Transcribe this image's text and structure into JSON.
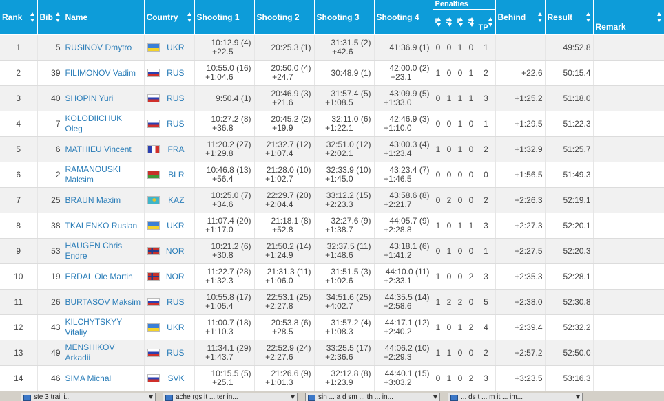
{
  "headers": {
    "rank": "Rank",
    "bib": "Bib",
    "name": "Name",
    "country": "Country",
    "shooting1": "Shooting 1",
    "shooting2": "Shooting 2",
    "shooting3": "Shooting 3",
    "shooting4": "Shooting 4",
    "penalties": "Penalties",
    "pen_cols": [
      "P",
      "S",
      "P",
      "S",
      "TP"
    ],
    "behind": "Behind",
    "result": "Result",
    "remark": "Remark"
  },
  "flag_colors": {
    "UKR": [
      "#3b7fd6",
      "#f3d22a"
    ],
    "RUS": [
      "#ffffff",
      "#2a3fb0",
      "#d0302b"
    ],
    "FRA": [
      "#2a3fb0",
      "#ffffff",
      "#d0302b"
    ],
    "BLR": [
      "#c8312a",
      "#3f9a3a"
    ],
    "KAZ": [
      "#3fb5c9",
      "#e2c02a"
    ],
    "NOR": [
      "#c8312a",
      "#ffffff",
      "#233c8c"
    ],
    "SVK": [
      "#ffffff",
      "#2a3fb0",
      "#d0302b"
    ]
  },
  "rows": [
    {
      "rank": "1",
      "bib": "5",
      "name": "RUSINOV Dmytro",
      "country": "UKR",
      "s1": "10:12.9",
      "s1p": "(4)",
      "s1b": "+22.5",
      "s2": "20:25.3",
      "s2p": "(1)",
      "s2b": "",
      "s3": "31:31.5",
      "s3p": "(2)",
      "s3b": "+42.6",
      "s4": "41:36.9",
      "s4p": "(1)",
      "s4b": "",
      "pen": [
        "0",
        "0",
        "1",
        "0",
        "1"
      ],
      "behind": "",
      "result": "49:52.8",
      "remark": ""
    },
    {
      "rank": "2",
      "bib": "39",
      "name": "FILIMONOV Vadim",
      "country": "RUS",
      "s1": "10:55.0",
      "s1p": "(16)",
      "s1b": "+1:04.6",
      "s2": "20:50.0",
      "s2p": "(4)",
      "s2b": "+24.7",
      "s3": "30:48.9",
      "s3p": "(1)",
      "s3b": "",
      "s4": "42:00.0",
      "s4p": "(2)",
      "s4b": "+23.1",
      "pen": [
        "1",
        "0",
        "0",
        "1",
        "2"
      ],
      "behind": "+22.6",
      "result": "50:15.4",
      "remark": ""
    },
    {
      "rank": "3",
      "bib": "40",
      "name": "SHOPIN Yuri",
      "country": "RUS",
      "s1": "9:50.4",
      "s1p": "(1)",
      "s1b": "",
      "s2": "20:46.9",
      "s2p": "(3)",
      "s2b": "+21.6",
      "s3": "31:57.4",
      "s3p": "(5)",
      "s3b": "+1:08.5",
      "s4": "43:09.9",
      "s4p": "(5)",
      "s4b": "+1:33.0",
      "pen": [
        "0",
        "1",
        "1",
        "1",
        "3"
      ],
      "behind": "+1:25.2",
      "result": "51:18.0",
      "remark": ""
    },
    {
      "rank": "4",
      "bib": "7",
      "name": "KOLODIICHUK Oleg",
      "country": "RUS",
      "s1": "10:27.2",
      "s1p": "(8)",
      "s1b": "+36.8",
      "s2": "20:45.2",
      "s2p": "(2)",
      "s2b": "+19.9",
      "s3": "32:11.0",
      "s3p": "(6)",
      "s3b": "+1:22.1",
      "s4": "42:46.9",
      "s4p": "(3)",
      "s4b": "+1:10.0",
      "pen": [
        "0",
        "0",
        "1",
        "0",
        "1"
      ],
      "behind": "+1:29.5",
      "result": "51:22.3",
      "remark": ""
    },
    {
      "rank": "5",
      "bib": "6",
      "name": "MATHIEU Vincent",
      "country": "FRA",
      "s1": "11:20.2",
      "s1p": "(27)",
      "s1b": "+1:29.8",
      "s2": "21:32.7",
      "s2p": "(12)",
      "s2b": "+1:07.4",
      "s3": "32:51.0",
      "s3p": "(12)",
      "s3b": "+2:02.1",
      "s4": "43:00.3",
      "s4p": "(4)",
      "s4b": "+1:23.4",
      "pen": [
        "1",
        "0",
        "1",
        "0",
        "2"
      ],
      "behind": "+1:32.9",
      "result": "51:25.7",
      "remark": ""
    },
    {
      "rank": "6",
      "bib": "2",
      "name": "RAMANOUSKI Maksim",
      "country": "BLR",
      "s1": "10:46.8",
      "s1p": "(13)",
      "s1b": "+56.4",
      "s2": "21:28.0",
      "s2p": "(10)",
      "s2b": "+1:02.7",
      "s3": "32:33.9",
      "s3p": "(10)",
      "s3b": "+1:45.0",
      "s4": "43:23.4",
      "s4p": "(7)",
      "s4b": "+1:46.5",
      "pen": [
        "0",
        "0",
        "0",
        "0",
        "0"
      ],
      "behind": "+1:56.5",
      "result": "51:49.3",
      "remark": ""
    },
    {
      "rank": "7",
      "bib": "25",
      "name": "BRAUN Maxim",
      "country": "KAZ",
      "s1": "10:25.0",
      "s1p": "(7)",
      "s1b": "+34.6",
      "s2": "22:29.7",
      "s2p": "(20)",
      "s2b": "+2:04.4",
      "s3": "33:12.2",
      "s3p": "(15)",
      "s3b": "+2:23.3",
      "s4": "43:58.6",
      "s4p": "(8)",
      "s4b": "+2:21.7",
      "pen": [
        "0",
        "2",
        "0",
        "0",
        "2"
      ],
      "behind": "+2:26.3",
      "result": "52:19.1",
      "remark": ""
    },
    {
      "rank": "8",
      "bib": "38",
      "name": "TKALENKO Ruslan",
      "country": "UKR",
      "s1": "11:07.4",
      "s1p": "(20)",
      "s1b": "+1:17.0",
      "s2": "21:18.1",
      "s2p": "(8)",
      "s2b": "+52.8",
      "s3": "32:27.6",
      "s3p": "(9)",
      "s3b": "+1:38.7",
      "s4": "44:05.7",
      "s4p": "(9)",
      "s4b": "+2:28.8",
      "pen": [
        "1",
        "0",
        "1",
        "1",
        "3"
      ],
      "behind": "+2:27.3",
      "result": "52:20.1",
      "remark": ""
    },
    {
      "rank": "9",
      "bib": "53",
      "name": "HAUGEN Chris Endre",
      "country": "NOR",
      "s1": "10:21.2",
      "s1p": "(6)",
      "s1b": "+30.8",
      "s2": "21:50.2",
      "s2p": "(14)",
      "s2b": "+1:24.9",
      "s3": "32:37.5",
      "s3p": "(11)",
      "s3b": "+1:48.6",
      "s4": "43:18.1",
      "s4p": "(6)",
      "s4b": "+1:41.2",
      "pen": [
        "0",
        "1",
        "0",
        "0",
        "1"
      ],
      "behind": "+2:27.5",
      "result": "52:20.3",
      "remark": ""
    },
    {
      "rank": "10",
      "bib": "19",
      "name": "ERDAL Ole Martin",
      "country": "NOR",
      "s1": "11:22.7",
      "s1p": "(28)",
      "s1b": "+1:32.3",
      "s2": "21:31.3",
      "s2p": "(11)",
      "s2b": "+1:06.0",
      "s3": "31:51.5",
      "s3p": "(3)",
      "s3b": "+1:02.6",
      "s4": "44:10.0",
      "s4p": "(11)",
      "s4b": "+2:33.1",
      "pen": [
        "1",
        "0",
        "0",
        "2",
        "3"
      ],
      "behind": "+2:35.3",
      "result": "52:28.1",
      "remark": ""
    },
    {
      "rank": "11",
      "bib": "26",
      "name": "BURTASOV Maksim",
      "country": "RUS",
      "s1": "10:55.8",
      "s1p": "(17)",
      "s1b": "+1:05.4",
      "s2": "22:53.1",
      "s2p": "(25)",
      "s2b": "+2:27.8",
      "s3": "34:51.6",
      "s3p": "(25)",
      "s3b": "+4:02.7",
      "s4": "44:35.5",
      "s4p": "(14)",
      "s4b": "+2:58.6",
      "pen": [
        "1",
        "2",
        "2",
        "0",
        "5"
      ],
      "behind": "+2:38.0",
      "result": "52:30.8",
      "remark": ""
    },
    {
      "rank": "12",
      "bib": "43",
      "name": "KILCHYTSKYY Vitaliy",
      "country": "UKR",
      "s1": "11:00.7",
      "s1p": "(18)",
      "s1b": "+1:10.3",
      "s2": "20:53.8",
      "s2p": "(6)",
      "s2b": "+28.5",
      "s3": "31:57.2",
      "s3p": "(4)",
      "s3b": "+1:08.3",
      "s4": "44:17.1",
      "s4p": "(12)",
      "s4b": "+2:40.2",
      "pen": [
        "1",
        "0",
        "1",
        "2",
        "4"
      ],
      "behind": "+2:39.4",
      "result": "52:32.2",
      "remark": ""
    },
    {
      "rank": "13",
      "bib": "49",
      "name": "MENSHIKOV Arkadii",
      "country": "RUS",
      "s1": "11:34.1",
      "s1p": "(29)",
      "s1b": "+1:43.7",
      "s2": "22:52.9",
      "s2p": "(24)",
      "s2b": "+2:27.6",
      "s3": "33:25.5",
      "s3p": "(17)",
      "s3b": "+2:36.6",
      "s4": "44:06.2",
      "s4p": "(10)",
      "s4b": "+2:29.3",
      "pen": [
        "1",
        "1",
        "0",
        "0",
        "2"
      ],
      "behind": "+2:57.2",
      "result": "52:50.0",
      "remark": ""
    },
    {
      "rank": "14",
      "bib": "46",
      "name": "SIMA Michal",
      "country": "SVK",
      "s1": "10:15.5",
      "s1p": "(5)",
      "s1b": "+25.1",
      "s2": "21:26.6",
      "s2p": "(9)",
      "s2b": "+1:01.3",
      "s3": "32:12.8",
      "s3p": "(8)",
      "s3b": "+1:23.9",
      "s4": "44:40.1",
      "s4p": "(15)",
      "s4b": "+3:03.2",
      "pen": [
        "0",
        "1",
        "0",
        "2",
        "3"
      ],
      "behind": "+3:23.5",
      "result": "53:16.3",
      "remark": ""
    }
  ],
  "taskbar": [
    "ste 3 trail i...",
    "ache rgs it ... ter in...",
    "sin ... a d sm ... th ... in...",
    "... ds t ... m it ... im..."
  ]
}
